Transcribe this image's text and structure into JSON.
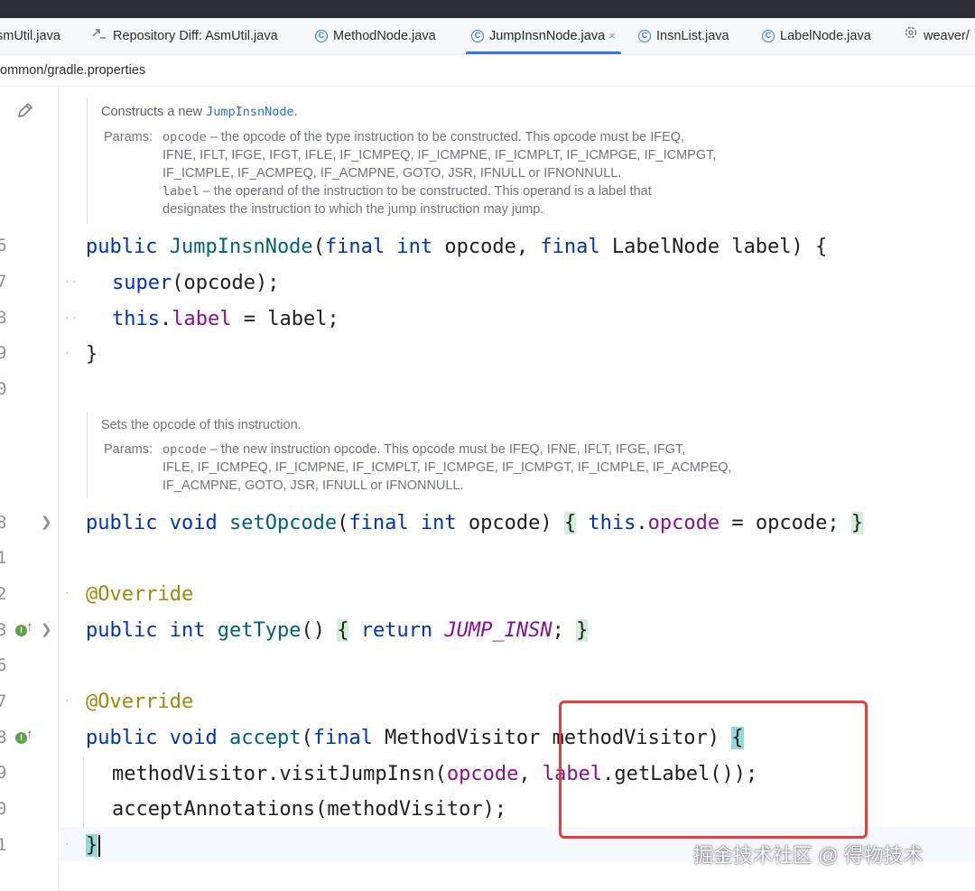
{
  "tabs": [
    {
      "label": "smUtil.java",
      "icon": "none"
    },
    {
      "label": "Repository Diff: AsmUtil.java",
      "icon": "diff-icon"
    },
    {
      "label": "MethodNode.java",
      "icon": "class-icon"
    },
    {
      "label": "JumpInsnNode.java",
      "icon": "class-icon",
      "active": true,
      "close": "×"
    },
    {
      "label": "InsnList.java",
      "icon": "class-icon"
    },
    {
      "label": "LabelNode.java",
      "icon": "class-icon"
    },
    {
      "label": "weaver/",
      "icon": "gear-icon"
    }
  ],
  "breadcrumb": "ommon/gradle.properties",
  "doc1": {
    "summary_prefix": "Constructs a new ",
    "summary_link": "JumpInsnNode",
    "summary_suffix": ".",
    "params_label": "Params:",
    "p1_name": "opcode",
    "p1_line1": " – the opcode of the type instruction to be constructed. This opcode must be IFEQ,",
    "p1_line2": "IFNE, IFLT, IFGE, IFGT, IFLE, IF_ICMPEQ, IF_ICMPNE, IF_ICMPLT, IF_ICMPGE, IF_ICMPGT,",
    "p1_line3": "IF_ICMPLE, IF_ACMPEQ, IF_ACMPNE, GOTO, JSR, IFNULL or IFNONNULL.",
    "p2_name": "label",
    "p2_line1": " – the operand of the instruction to be constructed. This operand is a label that",
    "p2_line2": "designates the instruction to which the jump instruction may jump."
  },
  "doc2": {
    "summary": "Sets the opcode of this instruction.",
    "params_label": "Params:",
    "p1_name": "opcode",
    "p1_line1": " – the new instruction opcode. This opcode must be IFEQ, IFNE, IFLT, IFGE, IFGT,",
    "p1_line2": "IFLE, IF_ICMPEQ, IF_ICMPNE, IF_ICMPLT, IF_ICMPGE, IF_ICMPGT, IF_ICMPLE, IF_ACMPEQ,",
    "p1_line3": "IF_ACMPNE, GOTO, JSR, IFNULL or IFNONNULL."
  },
  "line_numbers": [
    "6",
    "7",
    "8",
    "9",
    "0",
    "8",
    "1",
    "2",
    "3",
    "6",
    "7",
    "8",
    "9",
    "0",
    "1"
  ],
  "code": {
    "ctor_public": "public",
    "ctor_name": "JumpInsnNode",
    "ctor_open": "(",
    "ctor_final1": "final",
    "ctor_int": "int",
    "ctor_opcode": " opcode, ",
    "ctor_final2": "final",
    "ctor_label": " LabelNode label) {",
    "super_kw": "super",
    "super_rest": "(opcode);",
    "this_kw": "this",
    "this_dot": ".",
    "this_field": "label",
    "this_rest": " = label;",
    "close_brace": "}",
    "set_public": "public",
    "set_void": "void",
    "set_name": "setOpcode",
    "set_open": "(",
    "set_final": "final",
    "set_int": "int",
    "set_param": " opcode)",
    "set_lbrace": "{",
    "set_this": "this",
    "set_dot": ".",
    "set_field": "opcode",
    "set_assign": " = opcode; ",
    "set_rbrace": "}",
    "override1": "@Override",
    "gt_public": "public",
    "gt_int": "int",
    "gt_name": "getType",
    "gt_parens": "()",
    "gt_lbrace": "{",
    "gt_return": "return",
    "gt_const": "JUMP_INSN",
    "gt_semi": ";",
    "gt_rbrace": "}",
    "override2": "@Override",
    "ac_public": "public",
    "ac_void": "void",
    "ac_name": "accept",
    "ac_open": "(",
    "ac_final": "final",
    "ac_rest": " MethodVisitor methodVisitor) ",
    "ac_lbrace": "{",
    "visit_pre": "methodVisitor.visitJumpInsn(",
    "visit_opcode": "opcode",
    "visit_mid": ", ",
    "visit_label": "label",
    "visit_post": ".getLabel());",
    "annot_line": "acceptAnnotations(methodVisitor);",
    "final_brace": "}"
  },
  "watermark": "掘金技术社区 @ 得物技术",
  "colors": {
    "keyword": "#0033b3",
    "function": "#00627a",
    "field": "#871094",
    "annotation": "#9e880d",
    "highlight_box": "#e0413c"
  }
}
